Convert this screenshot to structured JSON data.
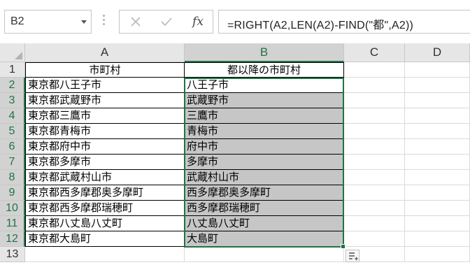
{
  "formula_bar": {
    "name_box": "B2",
    "cancel_icon": "close-icon",
    "enter_icon": "check-icon",
    "fx_label": "fx",
    "formula": "=RIGHT(A2,LEN(A2)-FIND(\"都\",A2))"
  },
  "columns": [
    "A",
    "B",
    "C",
    "D"
  ],
  "rows": [
    "1",
    "2",
    "3",
    "4",
    "5",
    "6",
    "7",
    "8",
    "9",
    "10",
    "11",
    "12",
    "13"
  ],
  "headers": {
    "a1": "市町村",
    "b1": "都以降の市町村"
  },
  "data": [
    {
      "a": "東京都八王子市",
      "b": "八王子市"
    },
    {
      "a": "東京都武蔵野市",
      "b": "武蔵野市"
    },
    {
      "a": "東京都三鷹市",
      "b": "三鷹市"
    },
    {
      "a": "東京都青梅市",
      "b": "青梅市"
    },
    {
      "a": "東京都府中市",
      "b": "府中市"
    },
    {
      "a": "東京都多摩市",
      "b": "多摩市"
    },
    {
      "a": "東京都武蔵村山市",
      "b": "武蔵村山市"
    },
    {
      "a": "東京都西多摩郡奥多摩町",
      "b": "西多摩郡奥多摩町"
    },
    {
      "a": "東京都西多摩郡瑞穂町",
      "b": "西多摩郡瑞穂町"
    },
    {
      "a": "東京都八丈島八丈町",
      "b": "八丈島八丈町"
    },
    {
      "a": "東京都大島町",
      "b": "大島町"
    }
  ],
  "colors": {
    "accent": "#217346",
    "shade": "#c6c6c6",
    "header_bg": "#e6e6e6"
  }
}
